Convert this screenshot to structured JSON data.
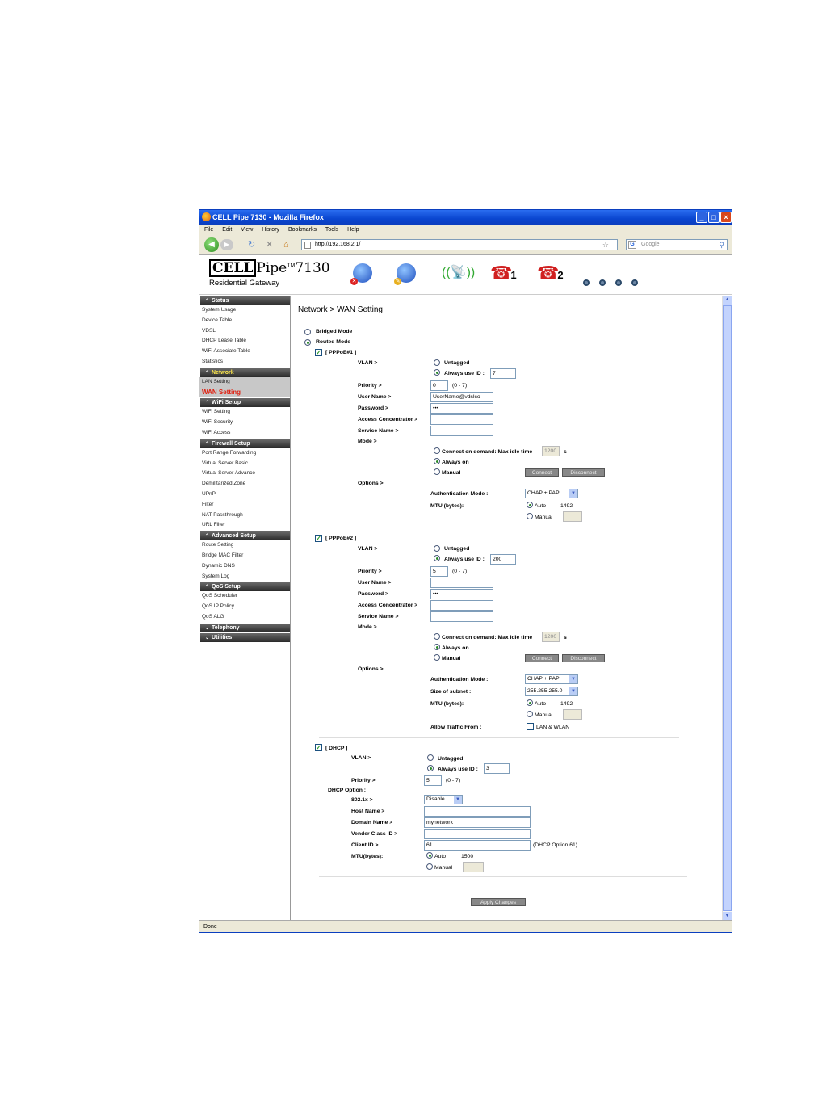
{
  "window": {
    "title": "CELL Pipe 7130 - Mozilla Firefox",
    "status": "Done"
  },
  "menu": [
    "File",
    "Edit",
    "View",
    "History",
    "Bookmarks",
    "Tools",
    "Help"
  ],
  "url": "http://192.168.2.1/",
  "search_placeholder": "Google",
  "logo": {
    "brand": "CELL",
    "pipe": "Pipe",
    "tm": "TM",
    "model": "7130",
    "subtitle": "Residential Gateway"
  },
  "header_icons": [
    "globe-internet-icon",
    "globe-network-icon",
    "wifi-antenna-icon",
    "phone-line-1-icon",
    "phone-line-2-icon"
  ],
  "header_icon_labels": {
    "phone1": "1",
    "phone2": "2"
  },
  "sidebar": {
    "status": {
      "title": "Status",
      "items": [
        "System Usage",
        "Device Table",
        "VDSL",
        "DHCP Lease Table",
        "WiFi Associate Table",
        "Statistics"
      ]
    },
    "network": {
      "title": "Network",
      "items": [
        "LAN Setting",
        "WAN Setting"
      ]
    },
    "wifi": {
      "title": "WiFi Setup",
      "items": [
        "WiFi Setting",
        "WiFi Security",
        "WiFi Access"
      ]
    },
    "firewall": {
      "title": "Firewall Setup",
      "items": [
        "Port Range Forwarding",
        "Virtual Server Basic",
        "Virtual Server Advance",
        "Demilitarized Zone",
        "UPnP",
        "Filter",
        "NAT Passthrough",
        "URL Filter"
      ]
    },
    "advanced": {
      "title": "Advanced Setup",
      "items": [
        "Route Setting",
        "Bridge MAC Filter",
        "Dynamic DNS",
        "System Log"
      ]
    },
    "qos": {
      "title": "QoS Setup",
      "items": [
        "QoS Scheduler",
        "QoS IP Policy",
        "QoS ALG"
      ]
    },
    "telephony": {
      "title": "Telephony"
    },
    "utilities": {
      "title": "Utilities"
    }
  },
  "page": {
    "title": "Network > WAN Setting",
    "mode_bridged": "Bridged Mode",
    "mode_routed": "Routed Mode",
    "selected_mode": "routed",
    "labels": {
      "vlan": "VLAN >",
      "untagged": "Untagged",
      "always_use_id": "Always use ID :",
      "priority": "Priority >",
      "priority_range": "(0 - 7)",
      "user_name": "User Name >",
      "password": "Password >",
      "access_concentrator": "Access Concentrator >",
      "service_name": "Service Name >",
      "mode": "Mode >",
      "connect_on_demand": "Connect on demand: Max idle time",
      "seconds": "s",
      "always_on": "Always on",
      "manual": "Manual",
      "connect": "Connect",
      "disconnect": "Disconnect",
      "options": "Options >",
      "auth_mode": "Authentication Mode :",
      "mtu": "MTU (bytes):",
      "auto": "Auto",
      "manual_mtu": "Manual",
      "size_of_subnet": "Size of subnet :",
      "allow_traffic_from": "Allow Traffic From :",
      "lan_wlan": "LAN & WLAN",
      "dhcp_option": "DHCP Option :",
      "dot1x": "802.1x >",
      "host_name": "Host Name >",
      "domain_name": "Domain Name >",
      "vender_class_id": "Vender Class ID >",
      "client_id": "Client ID >",
      "mtu_dhcp": "MTU(bytes):",
      "dhcp_option_61": "(DHCP Option 61)",
      "apply": "Apply Changes"
    },
    "pppoe1": {
      "title": "[ PPPoE#1 ]",
      "enabled": true,
      "vlan_id": "7",
      "priority": "0",
      "user_name": "UserName@vdslco",
      "password": "•••",
      "access_concentrator": "",
      "service_name": "",
      "idle_time": "1200",
      "auth_mode": "CHAP + PAP",
      "mtu_value": "1492"
    },
    "pppoe2": {
      "title": "[ PPPoE#2 ]",
      "enabled": true,
      "vlan_id": "200",
      "priority": "5",
      "user_name": "",
      "password": "•••",
      "access_concentrator": "",
      "service_name": "",
      "idle_time": "1200",
      "auth_mode": "CHAP + PAP",
      "subnet": "255.255.255.0",
      "mtu_value": "1492"
    },
    "dhcp": {
      "title": "[ DHCP ]",
      "enabled": true,
      "vlan_id": "3",
      "priority": "5",
      "dot1x": "Disable",
      "host_name": "",
      "domain_name": "mynetwork",
      "vender_class_id": "",
      "client_id": "61",
      "mtu_value": "1500"
    }
  },
  "colors": {
    "sidebar_current": "#e02010",
    "section_active": "#ffe94a",
    "titlebar": "#0a46d0"
  }
}
